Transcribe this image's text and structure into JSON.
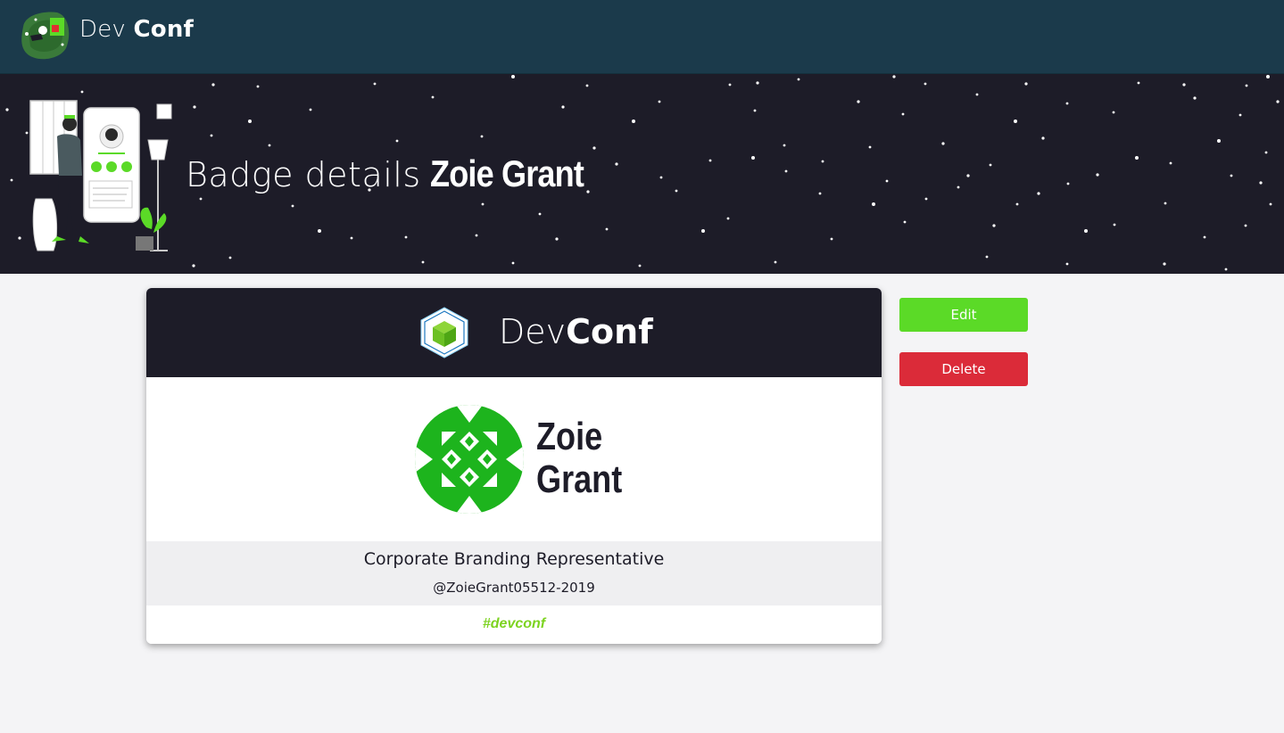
{
  "navbar": {
    "brand_light": "Dev",
    "brand_bold": "Conf"
  },
  "hero": {
    "title_lead": "Badge details",
    "title_name": "Zoie Grant"
  },
  "badge": {
    "header_brand_light": "Dev",
    "header_brand_bold": "Conf",
    "first_name": "Zoie",
    "last_name": "Grant",
    "job_title": "Corporate Branding Representative",
    "handle": "@ZoieGrant05512-2019",
    "hashtag": "#devconf",
    "avatar_color": "#1db41d"
  },
  "actions": {
    "edit_label": "Edit",
    "delete_label": "Delete"
  },
  "colors": {
    "navbar_bg": "#1b3a4b",
    "hero_bg": "#1d1c28",
    "accent_green": "#7dd321",
    "edit_green": "#5bda27",
    "delete_red": "#db2b39"
  },
  "icons": [
    "devconf-logo-icon",
    "devconf-cube-icon",
    "identicon-avatar",
    "hero-illustration"
  ]
}
